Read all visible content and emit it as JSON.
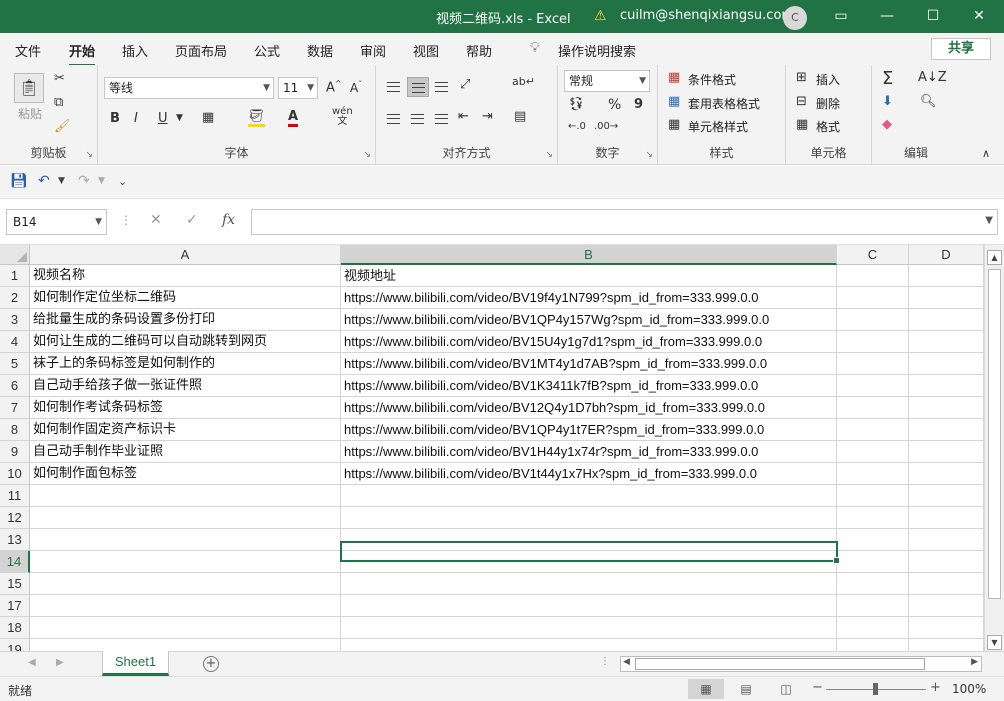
{
  "window": {
    "title": "视频二维码.xls  -  Excel",
    "user": "cuilm@shenqixiangsu.com",
    "avatar_initial": "C",
    "minimize": "—",
    "restore": "▢",
    "maximize": "☐",
    "close": "✕",
    "accent": "#217346"
  },
  "tabs": [
    "文件",
    "开始",
    "插入",
    "页面布局",
    "公式",
    "数据",
    "审阅",
    "视图",
    "帮助"
  ],
  "active_tab": "开始",
  "tell_me": "操作说明搜索",
  "share": "共享",
  "ribbon": {
    "clipboard": {
      "label": "剪贴板",
      "paste": "粘贴"
    },
    "font": {
      "label": "字体",
      "font_name": "等线",
      "font_size": "11",
      "bold": "B",
      "italic": "I",
      "underline": "U",
      "wen": "wén"
    },
    "alignment": {
      "label": "对齐方式"
    },
    "number": {
      "label": "数字",
      "format": "常规",
      "percent": "%",
      "comma": "9"
    },
    "styles": {
      "label": "样式",
      "conditional": "条件格式",
      "table": "套用表格格式",
      "cell_styles": "单元格样式"
    },
    "cells": {
      "label": "单元格",
      "insert": "插入",
      "delete": "删除",
      "format": "格式"
    },
    "editing": {
      "label": "编辑",
      "sum": "Σ"
    }
  },
  "namebox": "B14",
  "formula": "",
  "fx": "fx",
  "columns": [
    {
      "id": "A",
      "selected": false
    },
    {
      "id": "B",
      "selected": true
    },
    {
      "id": "C",
      "selected": false
    },
    {
      "id": "D",
      "selected": false
    }
  ],
  "rows": [
    {
      "n": "1",
      "a": "视频名称",
      "b": "视频地址"
    },
    {
      "n": "2",
      "a": "如何制作定位坐标二维码",
      "b": "https://www.bilibili.com/video/BV19f4y1N799?spm_id_from=333.999.0.0"
    },
    {
      "n": "3",
      "a": "给批量生成的条码设置多份打印",
      "b": "https://www.bilibili.com/video/BV1QP4y157Wg?spm_id_from=333.999.0.0"
    },
    {
      "n": "4",
      "a": "如何让生成的二维码可以自动跳转到网页",
      "b": "https://www.bilibili.com/video/BV15U4y1g7d1?spm_id_from=333.999.0.0"
    },
    {
      "n": "5",
      "a": "袜子上的条码标签是如何制作的",
      "b": "https://www.bilibili.com/video/BV1MT4y1d7AB?spm_id_from=333.999.0.0"
    },
    {
      "n": "6",
      "a": "自己动手给孩子做一张证件照",
      "b": "https://www.bilibili.com/video/BV1K3411k7fB?spm_id_from=333.999.0.0"
    },
    {
      "n": "7",
      "a": "如何制作考试条码标签",
      "b": "https://www.bilibili.com/video/BV12Q4y1D7bh?spm_id_from=333.999.0.0"
    },
    {
      "n": "8",
      "a": "如何制作固定资产标识卡",
      "b": "https://www.bilibili.com/video/BV1QP4y1t7ER?spm_id_from=333.999.0.0"
    },
    {
      "n": "9",
      "a": "自己动手制作毕业证照",
      "b": "https://www.bilibili.com/video/BV1H44y1x74r?spm_id_from=333.999.0.0"
    },
    {
      "n": "10",
      "a": "如何制作面包标签",
      "b": "https://www.bilibili.com/video/BV1t44y1x7Hx?spm_id_from=333.999.0.0"
    },
    {
      "n": "11",
      "a": "",
      "b": ""
    },
    {
      "n": "12",
      "a": "",
      "b": ""
    },
    {
      "n": "13",
      "a": "",
      "b": ""
    },
    {
      "n": "14",
      "a": "",
      "b": ""
    },
    {
      "n": "15",
      "a": "",
      "b": ""
    },
    {
      "n": "17",
      "a": "",
      "b": ""
    },
    {
      "n": "18",
      "a": "",
      "b": ""
    },
    {
      "n": "19",
      "a": "",
      "b": ""
    }
  ],
  "selected_row": "14",
  "sheet_tab": "Sheet1",
  "status": {
    "ready": "就绪",
    "zoom": "100%"
  }
}
